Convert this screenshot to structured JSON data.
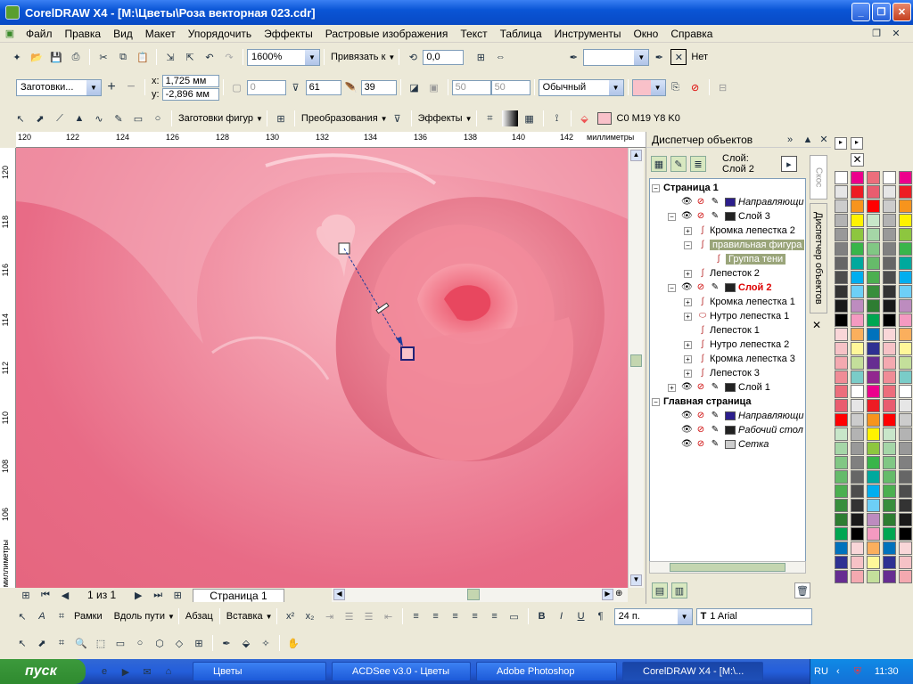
{
  "window": {
    "title": "CorelDRAW X4 - [M:\\Цветы\\Роза векторная 023.cdr]"
  },
  "menu": [
    "Файл",
    "Правка",
    "Вид",
    "Макет",
    "Упорядочить",
    "Эффекты",
    "Растровые изображения",
    "Текст",
    "Таблица",
    "Инструменты",
    "Окно",
    "Справка"
  ],
  "toolbar1": {
    "zoom": "1600%",
    "snap": "Привязать к",
    "angle": "0,0",
    "none_label": "Нет"
  },
  "toolbar2": {
    "presets": "Заготовки...",
    "x_label": "x:",
    "x": "1,725 мм",
    "y_label": "y:",
    "y": "-2,896 мм",
    "f0": "0",
    "f61": "61",
    "f39": "39",
    "f50a": "50",
    "f50b": "50",
    "mode": "Обычный"
  },
  "toolbar3": {
    "shapes": "Заготовки фигур",
    "transforms": "Преобразования",
    "effects": "Эффекты",
    "color": "C0 M19 Y8 K0"
  },
  "ruler": {
    "top": [
      "120",
      "122",
      "124",
      "126",
      "128",
      "130",
      "132",
      "134",
      "136",
      "138",
      "140",
      "142"
    ],
    "top_unit": "миллиметры",
    "left": [
      "120",
      "118",
      "116",
      "114",
      "112",
      "110",
      "108",
      "106"
    ],
    "left_unit": "миллиметры"
  },
  "pagebar": {
    "count": "1 из 1",
    "page": "Страница 1"
  },
  "docker": {
    "title": "Диспетчер объектов",
    "layer_label": "Слой:",
    "layer": "Слой 2",
    "tab1": "Скос",
    "tab2": "Диспетчер объектов"
  },
  "tree": [
    {
      "t": "Страница 1",
      "lvl": 0,
      "pm": "−",
      "bold": true
    },
    {
      "t": "Направляющи",
      "lvl": 1,
      "italic": true,
      "sw": "#2c1e8c",
      "vis": true
    },
    {
      "t": "Слой 3",
      "lvl": 1,
      "pm": "−",
      "sw": "#222",
      "vis": true
    },
    {
      "t": "Кромка лепестка 2",
      "lvl": 2,
      "pm": "+"
    },
    {
      "t": "правильная фигура",
      "lvl": 2,
      "pm": "−",
      "hl": true
    },
    {
      "t": "Группа тени",
      "lvl": 3,
      "hl": true
    },
    {
      "t": "Лепесток 2",
      "lvl": 2,
      "pm": "+"
    },
    {
      "t": "Слой 2",
      "lvl": 1,
      "pm": "−",
      "sw": "#222",
      "vis": true,
      "red": true
    },
    {
      "t": "Кромка лепестка 1",
      "lvl": 2,
      "pm": "+"
    },
    {
      "t": "Нутро лепестка 1",
      "lvl": 2,
      "pm": "+",
      "ell": true
    },
    {
      "t": "Лепесток 1",
      "lvl": 2
    },
    {
      "t": "Нутро лепестка 2",
      "lvl": 2,
      "pm": "+"
    },
    {
      "t": "Кромка лепестка 3",
      "lvl": 2,
      "pm": "+"
    },
    {
      "t": "Лепесток 3",
      "lvl": 2,
      "pm": "+"
    },
    {
      "t": "Слой 1",
      "lvl": 1,
      "pm": "+",
      "sw": "#222",
      "vis": true
    },
    {
      "t": "Главная страница",
      "lvl": 0,
      "pm": "−",
      "bold": true
    },
    {
      "t": "Направляющи",
      "lvl": 1,
      "italic": true,
      "sw": "#2c1e8c",
      "vis": true
    },
    {
      "t": "Рабочий стол",
      "lvl": 1,
      "italic": true,
      "sw": "#222",
      "vis": true
    },
    {
      "t": "Сетка",
      "lvl": 1,
      "italic": true,
      "sw": "#ccc",
      "vis": true
    }
  ],
  "bottom": {
    "frames": "Рамки",
    "along": "Вдоль пути",
    "para": "Абзац",
    "insert": "Вставка",
    "size": "24 п.",
    "font": "1 Arial"
  },
  "taskbar": {
    "start": "пуск",
    "tasks": [
      "Цветы",
      "ACDSee v3.0 - Цветы",
      "Adobe Photoshop",
      "CorelDRAW X4 - [M:\\..."
    ],
    "lang": "RU",
    "time": "11:30"
  },
  "palette": [
    "#ffffff",
    "#e6e6e6",
    "#cccccc",
    "#b3b3b3",
    "#999999",
    "#808080",
    "#666666",
    "#4d4d4d",
    "#333333",
    "#1a1a1a",
    "#000000",
    "#f9d6d8",
    "#f6c2c6",
    "#f4a9b0",
    "#f08c96",
    "#ec6e7c",
    "#e95d6f",
    "#ff0000",
    "#c8e6c9",
    "#a5d6a7",
    "#81c784",
    "#66bb6a",
    "#4caf50",
    "#388e3c",
    "#2e7d32",
    "#00a651",
    "#0072bc",
    "#2e3192",
    "#662d91",
    "#92278f",
    "#ec008c",
    "#ed1c24",
    "#f7941d",
    "#fff200",
    "#8dc63f",
    "#39b54a",
    "#00a99d",
    "#00aeef",
    "#6dcff6",
    "#bd8cbf",
    "#f49ac1",
    "#fbaf5d",
    "#fff799",
    "#c4df9b",
    "#7accc8"
  ]
}
